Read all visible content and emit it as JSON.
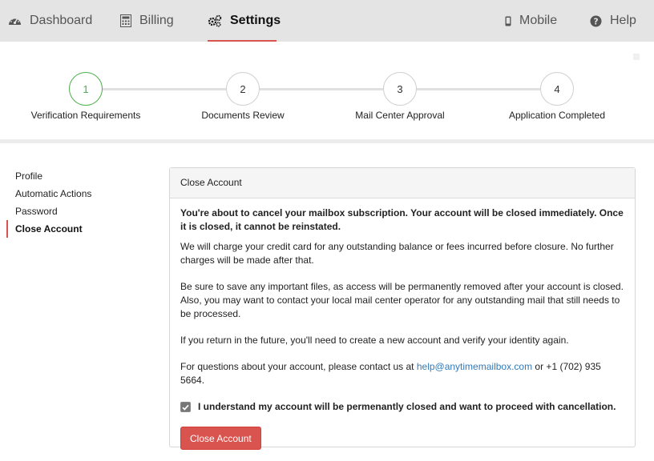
{
  "nav": {
    "dashboard": "Dashboard",
    "billing": "Billing",
    "settings": "Settings",
    "mobile": "Mobile",
    "help": "Help",
    "icons": [
      "dashboard-icon",
      "calculator-icon",
      "gears-icon",
      "mobile-icon",
      "question-circle-icon"
    ]
  },
  "stepper": {
    "steps": [
      {
        "number": "1",
        "label": "Verification Requirements"
      },
      {
        "number": "2",
        "label": "Documents Review"
      },
      {
        "number": "3",
        "label": "Mail Center Approval"
      },
      {
        "number": "4",
        "label": "Application Completed"
      }
    ]
  },
  "sidebar": {
    "items": [
      {
        "label": "Profile"
      },
      {
        "label": "Automatic Actions"
      },
      {
        "label": "Password"
      },
      {
        "label": "Close Account"
      }
    ]
  },
  "panel": {
    "title": "Close Account",
    "warning": "You're about to cancel your mailbox subscription. Your account will be closed immediately. Once it is closed, it cannot be reinstated.",
    "p_charge": "We will charge your credit card for any outstanding balance or fees incurred before closure. No further charges will be made after that.",
    "p_files": "Be sure to save any important files, as access will be permanently removed after your account is closed. Also, you may want to contact your local mail center operator for any outstanding mail that still needs to be processed.",
    "p_return": "If you return in the future, you'll need to create a new account and verify your identity again.",
    "p_contact_pre": "For questions about your account, please contact us at ",
    "email": "help@anytimemailbox.com",
    "p_contact_post": " or +1 (702) 935 5664.",
    "checkbox_label": "I understand my account will be permenantly closed and want to proceed with cancellation.",
    "checkbox_checked": true,
    "button_label": "Close Account"
  },
  "colors": {
    "accent": "#d9534f",
    "step_done": "#4cae4c",
    "link": "#337ab7"
  }
}
